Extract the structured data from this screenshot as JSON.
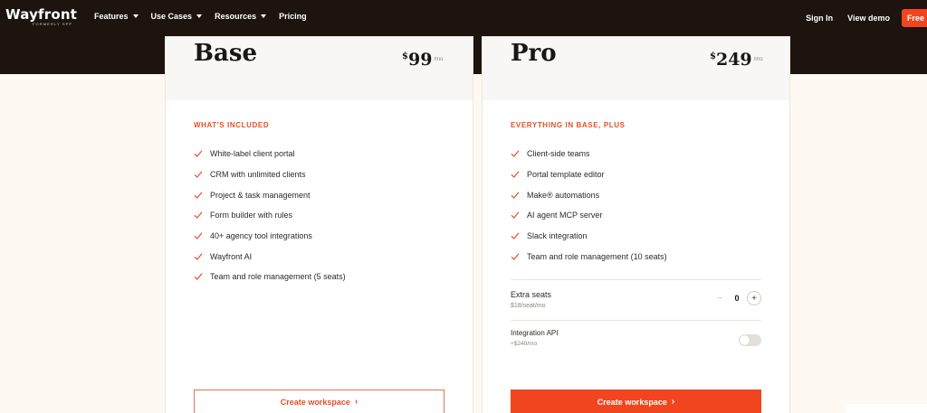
{
  "nav": {
    "logo": "Wayfront",
    "logo_sub": "FORMERLY SPP",
    "links": [
      {
        "label": "Features",
        "has_caret": true
      },
      {
        "label": "Use Cases",
        "has_caret": true
      },
      {
        "label": "Resources",
        "has_caret": true
      },
      {
        "label": "Pricing",
        "has_caret": false
      }
    ],
    "sign_in": "Sign In",
    "view_demo": "View demo",
    "free_button": "Free"
  },
  "plans": [
    {
      "name": "Base",
      "currency": "$",
      "amount": "99",
      "per": "/mo",
      "section_title": "WHAT'S INCLUDED",
      "features": [
        "White-label client portal",
        "CRM with unlimited clients",
        "Project & task management",
        "Form builder with rules",
        "40+ agency tool integrations",
        "Wayfront AI",
        "Team and role management (5 seats)"
      ],
      "cta": "Create workspace"
    },
    {
      "name": "Pro",
      "currency": "$",
      "amount": "249",
      "per": "/mo",
      "section_title": "EVERYTHING IN BASE, PLUS",
      "features": [
        "Client-side teams",
        "Portal template editor",
        "Make® automations",
        "AI agent MCP server",
        "Slack integration",
        "Team and role management (10 seats)"
      ],
      "addons": {
        "seats_label": "Extra seats",
        "seats_price": "$18/seat/mo",
        "seats_value": "0",
        "minus": "−",
        "plus": "+",
        "api_label": "Integration API",
        "api_price": "+$240/mo",
        "api_enabled": false
      },
      "cta": "Create workspace"
    }
  ],
  "colors": {
    "accent": "#f0451e",
    "dark": "#1d140f",
    "check": "#e0512a"
  },
  "icons": {
    "check": "check-icon",
    "chevron": "chevron-right-icon",
    "caret": "caret-down-icon"
  }
}
